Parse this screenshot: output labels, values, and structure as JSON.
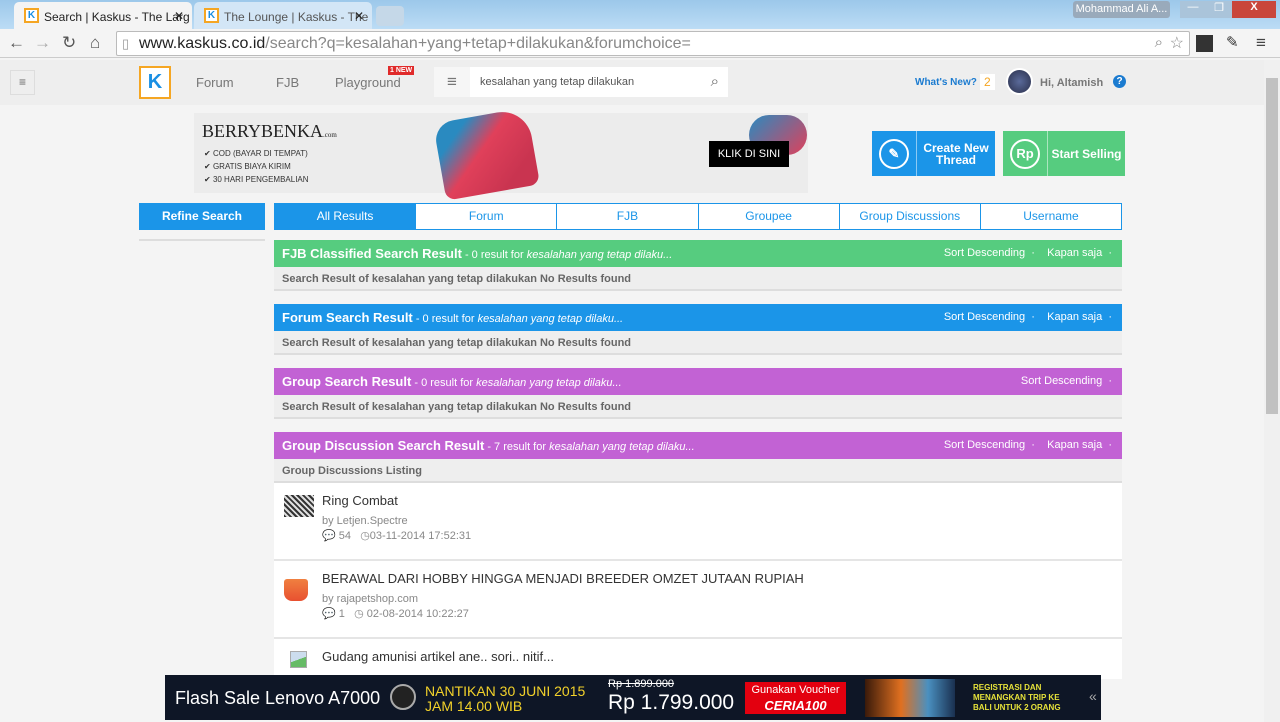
{
  "browser": {
    "tabs": [
      {
        "title": "Search | Kaskus - The Larg",
        "active": true
      },
      {
        "title": "The Lounge | Kaskus - The",
        "active": false
      }
    ],
    "profile": "Mohammad Ali A...",
    "url_host": "www.kaskus.co.id",
    "url_path": "/search?q=kesalahan+yang+tetap+dilakukan&forumchoice="
  },
  "header": {
    "logo": "K",
    "nav": [
      "Forum",
      "FJB",
      "Playground"
    ],
    "badge": "1 NEW",
    "search_value": "kesalahan yang tetap dilakukan",
    "whats_new": "What's New?",
    "notif_count": "2",
    "greeting": "Hi, Altamish",
    "help": "?"
  },
  "ad": {
    "brand": "BERRYBENKA",
    "brand_suffix": ".com",
    "points": [
      "COD (BAYAR DI TEMPAT)",
      "GRATIS BIAYA KIRIM",
      "30 HARI PENGEMBALIAN"
    ],
    "cta": "KLIK DI SINI"
  },
  "actions": {
    "create": "Create New Thread",
    "sell": "Start Selling",
    "sell_icon": "Rp"
  },
  "refine": "Refine Search",
  "tabs": [
    "All Results",
    "Forum",
    "FJB",
    "Groupee",
    "Group Discussions",
    "Username"
  ],
  "sections": [
    {
      "title": "FJB Classified Search Result",
      "count": " - 0 result for ",
      "query": "kesalahan yang tetap dilaku...",
      "sort": "Sort Descending",
      "time": "Kapan saja",
      "color": "#56cc7f",
      "sub": "Search Result of kesalahan yang tetap dilakukan No Results found"
    },
    {
      "title": "Forum Search Result",
      "count": " - 0 result for ",
      "query": "kesalahan yang tetap dilaku...",
      "sort": "Sort Descending",
      "time": "Kapan saja",
      "color": "#1b95e8",
      "sub": "Search Result of kesalahan yang tetap dilakukan No Results found"
    },
    {
      "title": "Group Search Result",
      "count": " - 0 result for ",
      "query": "kesalahan yang tetap dilaku...",
      "sort": "Sort Descending",
      "color": "#c262d4",
      "sub": "Search Result of kesalahan yang tetap dilakukan No Results found"
    },
    {
      "title": "Group Discussion Search Result",
      "count": " - 7 result for ",
      "query": "kesalahan yang tetap dilaku...",
      "sort": "Sort Descending",
      "time": "Kapan saja",
      "color": "#c262d4",
      "sub": "Group Discussions Listing"
    }
  ],
  "items": [
    {
      "title": "Ring Combat",
      "by": "by Letjen.Spectre",
      "replies": "54",
      "date": "03-11-2014 17:52:31"
    },
    {
      "title": "BERAWAL DARI HOBBY HINGGA MENJADI BREEDER OMZET JUTAAN RUPIAH",
      "by": "by rajapetshop.com",
      "replies": "1",
      "date": "02-08-2014 10:22:27"
    },
    {
      "title": "Gudang amunisi artikel ane.. sori.. nitif..."
    }
  ],
  "banner": {
    "title": "Flash Sale Lenovo A7000",
    "date1": "NANTIKAN 30 JUNI 2015",
    "date2": "JAM 14.00 WIB",
    "old_price": "Rp 1.899.000",
    "price": "Rp 1.799.000",
    "voucher1": "Gunakan Voucher",
    "voucher2": "CERIA100",
    "promo": "REGISTRASI DAN MENANGKAN TRIP KE BALI UNTUK 2 ORANG"
  }
}
